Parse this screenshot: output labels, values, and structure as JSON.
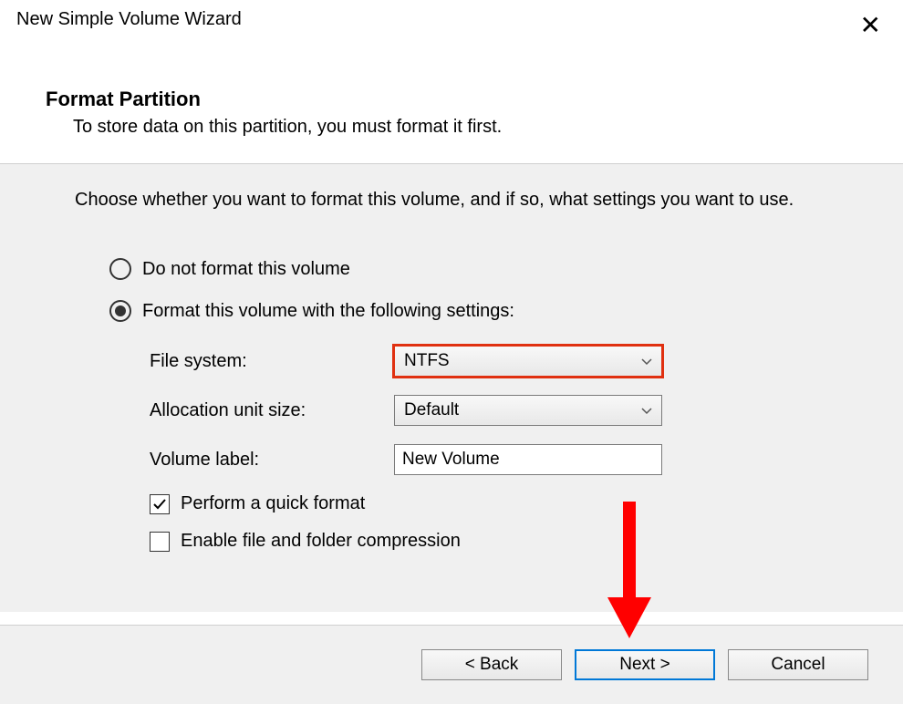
{
  "window": {
    "title": "New Simple Volume Wizard"
  },
  "header": {
    "title": "Format Partition",
    "subtitle": "To store data on this partition, you must format it first."
  },
  "instruction": "Choose whether you want to format this volume, and if so, what settings you want to use.",
  "radio": {
    "no_format_label": "Do not format this volume",
    "format_label": "Format this volume with the following settings:",
    "selected": "format"
  },
  "settings": {
    "file_system": {
      "label": "File system:",
      "value": "NTFS"
    },
    "allocation": {
      "label": "Allocation unit size:",
      "value": "Default"
    },
    "volume_label": {
      "label": "Volume label:",
      "value": "New Volume"
    }
  },
  "checkboxes": {
    "quick_format": {
      "label": "Perform a quick format",
      "checked": true
    },
    "compression": {
      "label": "Enable file and folder compression",
      "checked": false
    }
  },
  "buttons": {
    "back": "< Back",
    "next": "Next >",
    "cancel": "Cancel"
  }
}
